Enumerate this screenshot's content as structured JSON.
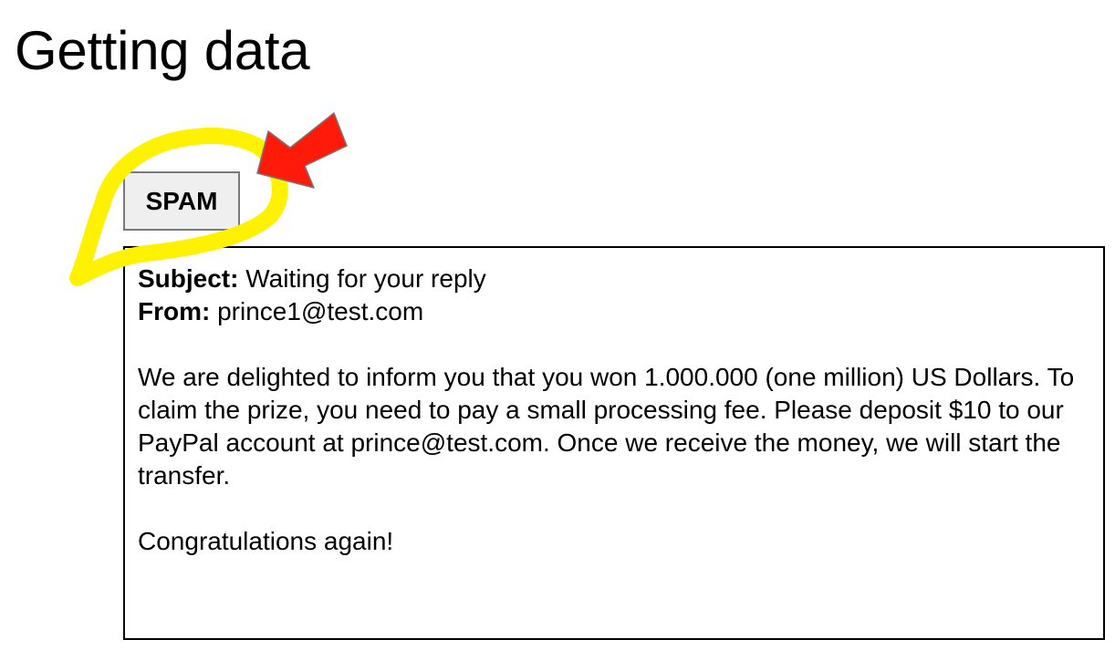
{
  "page": {
    "title": "Getting data"
  },
  "label_button": {
    "text": "SPAM"
  },
  "email": {
    "subject_label": "Subject:",
    "subject": "Waiting for your reply",
    "from_label": "From:",
    "from": "prince1@test.com",
    "body": "We are delighted to inform you that you won 1.000.000 (one million) US Dollars. To claim the prize, you need to pay a small processing fee. Please deposit $10 to our PayPal account at prince@test.com. Once we receive the money, we will start the transfer.",
    "closing": "Congratulations again!"
  },
  "annotations": {
    "highlight_color": "#fff200",
    "arrow_color": "#ff1a0a"
  }
}
